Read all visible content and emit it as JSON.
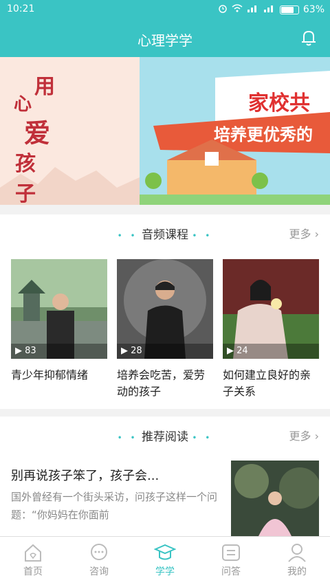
{
  "status_bar": {
    "time": "10:21",
    "battery": "63%"
  },
  "header": {
    "title": "心理学学"
  },
  "banner": {
    "left_text": [
      "用",
      "心",
      "爱",
      "孩子"
    ],
    "right_title": "家校共",
    "right_ribbon": "培养更优秀的"
  },
  "audio_section": {
    "title": "音频课程",
    "more": "更多",
    "items": [
      {
        "count": "83",
        "title": "青少年抑郁情绪"
      },
      {
        "count": "28",
        "title": "培养会吃苦，爱劳动的孩子"
      },
      {
        "count": "24",
        "title": "如何建立良好的亲子关系"
      }
    ]
  },
  "reading_section": {
    "title": "推荐阅读",
    "more": "更多",
    "article": {
      "title": "别再说孩子笨了，孩子会...",
      "desc": "国外曾经有一个街头采访，问孩子这样一个问题：“你妈妈在你面前"
    }
  },
  "tabbar": [
    {
      "label": "首页",
      "icon": "home-icon",
      "active": false
    },
    {
      "label": "咨询",
      "icon": "chat-icon",
      "active": false
    },
    {
      "label": "学学",
      "icon": "graduation-cap-icon",
      "active": true
    },
    {
      "label": "问答",
      "icon": "qa-icon",
      "active": false
    },
    {
      "label": "我的",
      "icon": "user-icon",
      "active": false
    }
  ],
  "colors": {
    "accent": "#3ac4c4"
  }
}
